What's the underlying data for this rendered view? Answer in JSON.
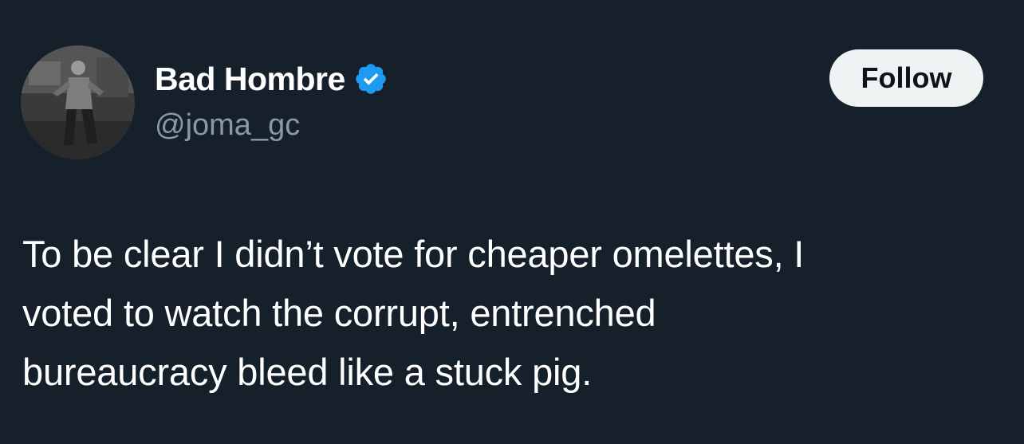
{
  "author": {
    "display_name": "Bad Hombre",
    "handle": "@joma_gc",
    "verified": true,
    "avatar_icon": "avatar-photo",
    "verified_icon": "verified-badge-icon"
  },
  "actions": {
    "follow_label": "Follow"
  },
  "tweet": {
    "lines": [
      "To be clear I didn’t vote for cheaper omelettes, I",
      "voted to watch the corrupt, entrenched",
      "bureaucracy bleed like a stuck pig."
    ]
  },
  "colors": {
    "background": "#15202b",
    "text": "#ffffff",
    "secondary_text": "#8b98a5",
    "verified": "#1d9bf0",
    "button_bg": "#eff3f4",
    "button_text": "#0f1419"
  }
}
